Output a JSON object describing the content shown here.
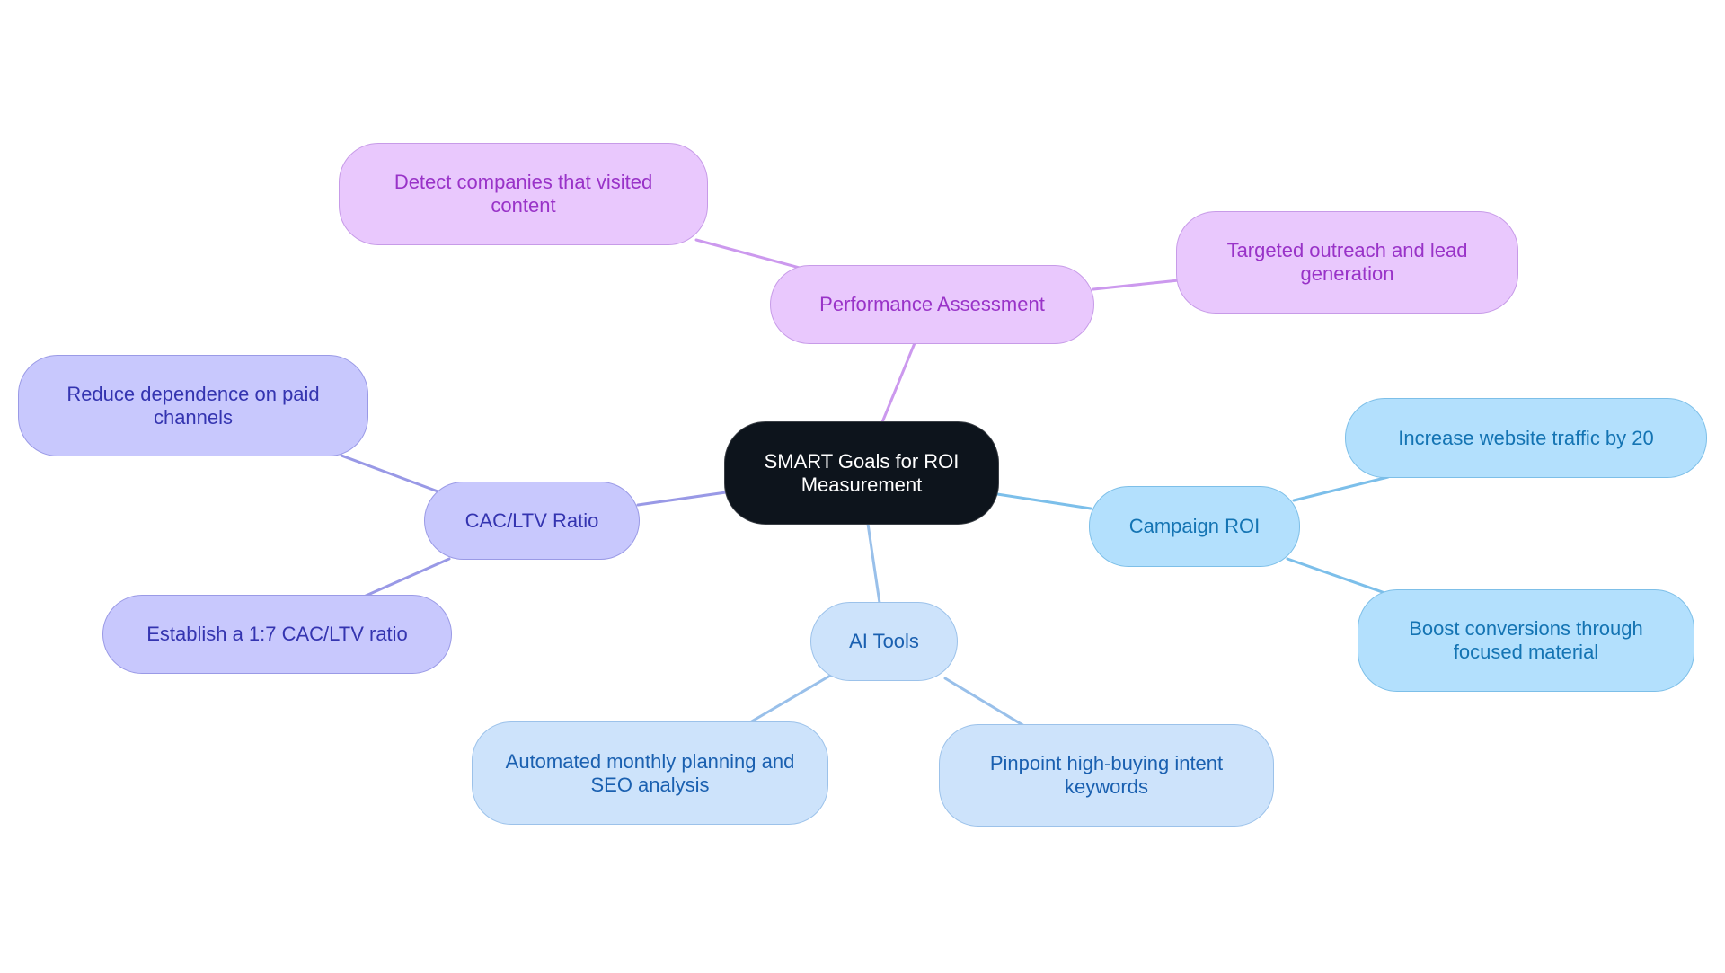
{
  "colors": {
    "root_fill": "#0d141c",
    "performance_branch": "#cc99ee",
    "cac_branch": "#9999e6",
    "campaign_branch": "#7cbfea",
    "ai_branch": "#99c0ea"
  },
  "root": {
    "label": "SMART Goals for ROI Measurement"
  },
  "branches": {
    "performance": {
      "label": "Performance Assessment",
      "children": [
        "Detect companies that visited content",
        "Targeted outreach and lead generation"
      ]
    },
    "cac": {
      "label": "CAC/LTV Ratio",
      "children": [
        "Reduce dependence on paid channels",
        "Establish a 1:7 CAC/LTV ratio"
      ]
    },
    "campaign": {
      "label": "Campaign ROI",
      "children": [
        "Increase website traffic by 20",
        "Boost conversions through focused material"
      ]
    },
    "ai": {
      "label": "AI Tools",
      "children": [
        "Automated monthly planning and SEO analysis",
        "Pinpoint high-buying intent keywords"
      ]
    }
  }
}
